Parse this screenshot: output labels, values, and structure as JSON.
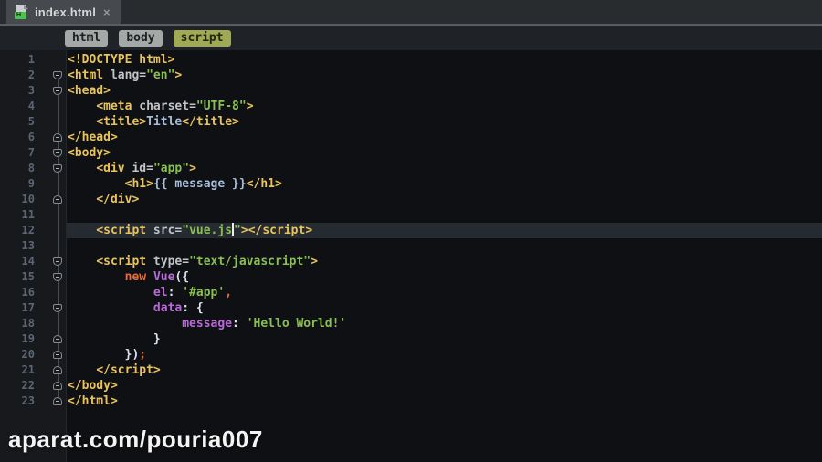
{
  "tab": {
    "title": "index.html",
    "close_glyph": "×",
    "icon_letter": "H"
  },
  "breadcrumbs": {
    "items": [
      {
        "label": "html",
        "active": false
      },
      {
        "label": "body",
        "active": false
      },
      {
        "label": "script",
        "active": true
      }
    ]
  },
  "editor": {
    "active_line": 12,
    "lines": [
      {
        "n": 1,
        "fold": null,
        "segments": [
          [
            "tag",
            "<!DOCTYPE html>"
          ]
        ]
      },
      {
        "n": 2,
        "fold": "open",
        "segments": [
          [
            "tag",
            "<html"
          ],
          [
            "attr",
            " lang="
          ],
          [
            "string",
            "\"en\""
          ],
          [
            "tag",
            ">"
          ]
        ]
      },
      {
        "n": 3,
        "fold": "open",
        "segments": [
          [
            "tag",
            "<head>"
          ]
        ]
      },
      {
        "n": 4,
        "fold": null,
        "segments": [
          [
            "plain",
            "    "
          ],
          [
            "tag",
            "<meta"
          ],
          [
            "attr",
            " charset="
          ],
          [
            "string",
            "\"UTF-8\""
          ],
          [
            "tag",
            ">"
          ]
        ]
      },
      {
        "n": 5,
        "fold": null,
        "segments": [
          [
            "plain",
            "    "
          ],
          [
            "tag",
            "<title>"
          ],
          [
            "text",
            "Title"
          ],
          [
            "tag",
            "</title>"
          ]
        ]
      },
      {
        "n": 6,
        "fold": "close",
        "segments": [
          [
            "tag",
            "</head>"
          ]
        ]
      },
      {
        "n": 7,
        "fold": "open",
        "segments": [
          [
            "tag",
            "<body>"
          ]
        ]
      },
      {
        "n": 8,
        "fold": "open",
        "segments": [
          [
            "plain",
            "    "
          ],
          [
            "tag",
            "<div"
          ],
          [
            "attr",
            " id="
          ],
          [
            "string",
            "\"app\""
          ],
          [
            "tag",
            ">"
          ]
        ]
      },
      {
        "n": 9,
        "fold": null,
        "segments": [
          [
            "plain",
            "        "
          ],
          [
            "tag",
            "<h1>"
          ],
          [
            "text",
            "{{ message }}"
          ],
          [
            "tag",
            "</h1>"
          ]
        ]
      },
      {
        "n": 10,
        "fold": "close",
        "segments": [
          [
            "plain",
            "    "
          ],
          [
            "tag",
            "</div>"
          ]
        ]
      },
      {
        "n": 11,
        "fold": null,
        "segments": []
      },
      {
        "n": 12,
        "fold": null,
        "segments": [
          [
            "plain",
            "    "
          ],
          [
            "tag",
            "<script"
          ],
          [
            "attr",
            " src="
          ],
          [
            "string",
            "\"vue.js"
          ],
          [
            "caret",
            ""
          ],
          [
            "string",
            "\""
          ],
          [
            "tag",
            "></script>"
          ]
        ]
      },
      {
        "n": 13,
        "fold": null,
        "segments": []
      },
      {
        "n": 14,
        "fold": "open",
        "segments": [
          [
            "plain",
            "    "
          ],
          [
            "tag",
            "<script"
          ],
          [
            "attr",
            " type="
          ],
          [
            "string",
            "\"text/javascript\""
          ],
          [
            "tag",
            ">"
          ]
        ]
      },
      {
        "n": 15,
        "fold": "open",
        "segments": [
          [
            "plain",
            "        "
          ],
          [
            "keyword",
            "new"
          ],
          [
            "plain",
            " "
          ],
          [
            "ident",
            "Vue"
          ],
          [
            "punct",
            "({"
          ]
        ]
      },
      {
        "n": 16,
        "fold": null,
        "segments": [
          [
            "plain",
            "            "
          ],
          [
            "ident",
            "el"
          ],
          [
            "punct",
            ": "
          ],
          [
            "string",
            "'#app'"
          ],
          [
            "sep",
            ","
          ]
        ]
      },
      {
        "n": 17,
        "fold": "open",
        "segments": [
          [
            "plain",
            "            "
          ],
          [
            "ident",
            "data"
          ],
          [
            "punct",
            ": {"
          ]
        ]
      },
      {
        "n": 18,
        "fold": null,
        "segments": [
          [
            "plain",
            "                "
          ],
          [
            "ident",
            "message"
          ],
          [
            "punct",
            ": "
          ],
          [
            "string",
            "'Hello World!'"
          ]
        ]
      },
      {
        "n": 19,
        "fold": "close",
        "segments": [
          [
            "plain",
            "            "
          ],
          [
            "punct",
            "}"
          ]
        ]
      },
      {
        "n": 20,
        "fold": "close",
        "segments": [
          [
            "plain",
            "        "
          ],
          [
            "punct",
            "})"
          ],
          [
            "sep",
            ";"
          ]
        ]
      },
      {
        "n": 21,
        "fold": "close",
        "segments": [
          [
            "plain",
            "    "
          ],
          [
            "tag",
            "</script>"
          ]
        ]
      },
      {
        "n": 22,
        "fold": "close",
        "segments": [
          [
            "tag",
            "</body>"
          ]
        ]
      },
      {
        "n": 23,
        "fold": "close",
        "segments": [
          [
            "tag",
            "</html>"
          ]
        ]
      }
    ]
  },
  "watermark": "aparat.com/pouria007",
  "colors": {
    "tokens": {
      "tag": "#e9c35c",
      "attr": "#c0c3c7",
      "string": "#8abf51",
      "text": "#a8bedb",
      "keyword": "#ee6a33",
      "ident": "#b96ad9",
      "punct": "#dbe3ee",
      "sep": "#ee6a33",
      "plain": "#c8ccd4"
    },
    "chrome": {
      "editor-bg": "#0f1013",
      "gutter-bg": "#17191d",
      "active-line-bg": "#262a31",
      "line-number": "#5d6572",
      "tab-bg": "#46494d",
      "tabstrip-bg": "#292c2f",
      "breadcrumb-bg": "#1f2226",
      "chip-bg": "#a4a8a7",
      "chip-active-bg": "#a0aa55",
      "accent-line": "#575c61"
    }
  }
}
